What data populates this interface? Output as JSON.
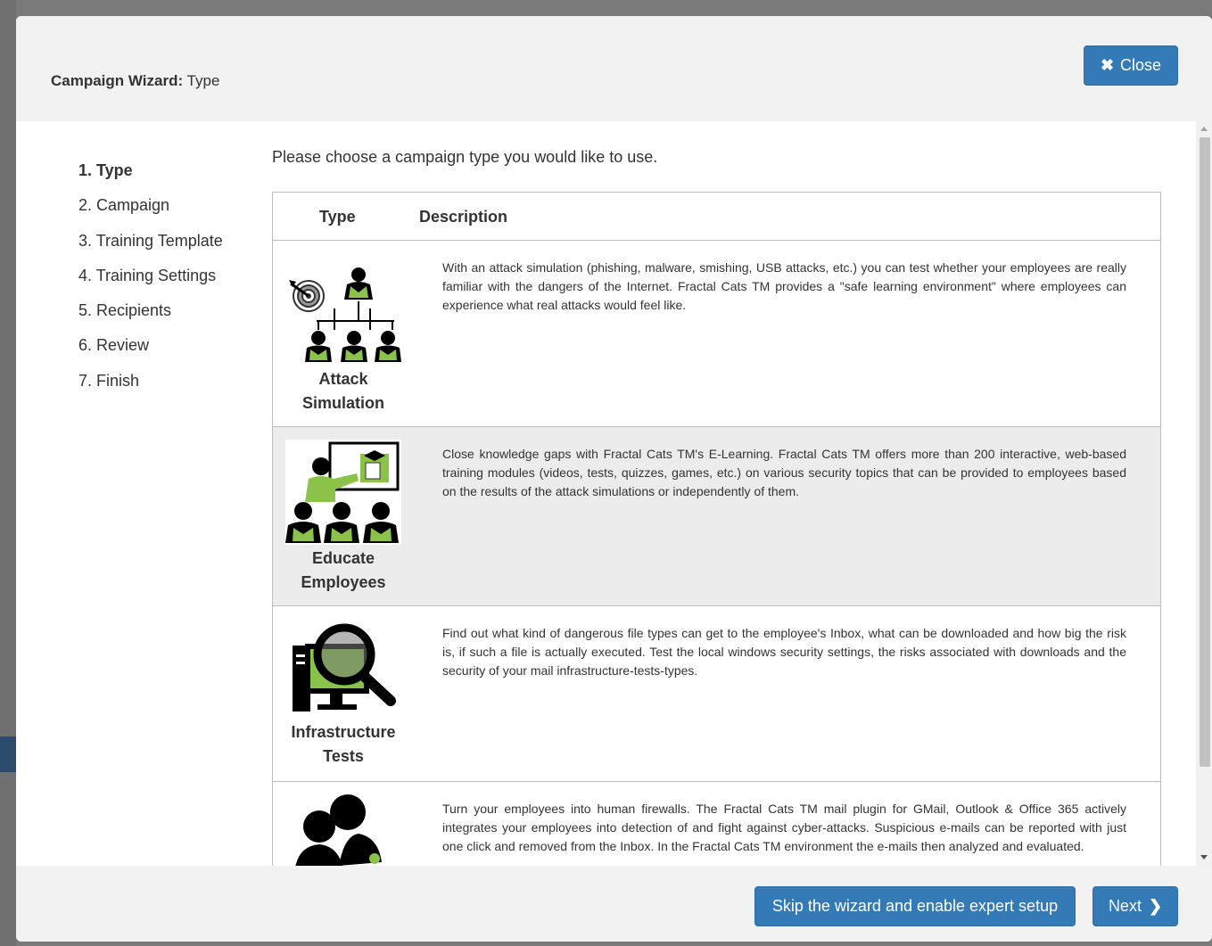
{
  "modal": {
    "title_bold": "Campaign Wizard:",
    "title_rest": " Type",
    "close_icon": "✖",
    "close_label": "Close"
  },
  "steps": [
    {
      "label": "1. Type",
      "active": true
    },
    {
      "label": "2. Campaign"
    },
    {
      "label": "3. Training Template"
    },
    {
      "label": "4. Training Settings"
    },
    {
      "label": "5. Recipients"
    },
    {
      "label": "6. Review"
    },
    {
      "label": "7. Finish"
    }
  ],
  "intro": "Please choose a campaign type you would like to use.",
  "table": {
    "col_type": "Type",
    "col_desc": "Description",
    "rows": [
      {
        "icon": "attack-simulation-icon",
        "label_line1": "Attack",
        "label_line2": "Simulation",
        "description": "With an attack simulation (phishing, malware, smishing, USB attacks, etc.) you can test whether your employees are really familiar with the dangers of the Internet. Fractal Cats TM provides a \"safe learning environment\" where employees can experience what real attacks would feel like."
      },
      {
        "icon": "educate-employees-icon",
        "label_line1": "Educate",
        "label_line2": "Employees",
        "description": "Close knowledge gaps with Fractal Cats TM's E-Learning. Fractal Cats TM offers more than 200 interactive, web-based training modules (videos, tests, quizzes, games, etc.) on various security topics that can be provided to employees based on the results of the attack simulations or independently of them."
      },
      {
        "icon": "infrastructure-tests-icon",
        "label_line1": "Infrastructure",
        "label_line2": "Tests",
        "description": "Find out what kind of dangerous file types can get to the employee's Inbox, what can be downloaded and how big the risk is, if such a file is actually executed. Test the local windows security settings, the risks associated with downloads and the security of your mail infrastructure-tests-types."
      },
      {
        "icon": "mail-plugin-icon",
        "description": "Turn your employees into human firewalls. The Fractal Cats TM mail plugin for GMail, Outlook & Office 365 actively integrates your employees into detection of and fight against cyber-attacks. Suspicious e-mails can be reported with just one click and removed from the Inbox. In the Fractal Cats TM environment the e-mails then analyzed and evaluated."
      }
    ]
  },
  "footer": {
    "skip_label": "Skip the wizard and enable expert setup",
    "next_label": "Next",
    "next_icon": "❯"
  },
  "colors": {
    "primary": "#337ab7",
    "icon_green": "#8bc34a",
    "header_bg": "#f2f2f2",
    "row_shade": "#ececec"
  }
}
